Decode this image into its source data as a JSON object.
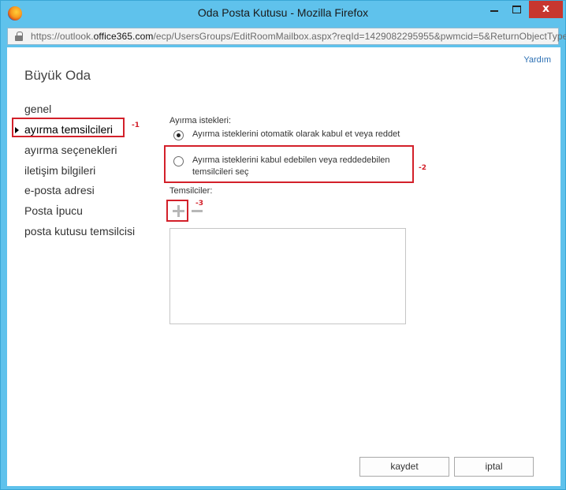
{
  "window": {
    "title": "Oda Posta Kutusu - Mozilla Firefox",
    "close_glyph": "x"
  },
  "address_bar": {
    "url_prefix": "https://outlook.",
    "url_domain": "office365.com",
    "url_path": "/ecp/UsersGroups/EditRoomMailbox.aspx?reqId=1429082295955&pwmcid=5&ReturnObjectType"
  },
  "page": {
    "help_label": "Yardım",
    "title": "Büyük Oda"
  },
  "nav": {
    "items": [
      {
        "label": "genel"
      },
      {
        "label": "ayırma temsilcileri"
      },
      {
        "label": "ayırma seçenekleri"
      },
      {
        "label": "iletişim bilgileri"
      },
      {
        "label": "e-posta adresi"
      },
      {
        "label": "Posta İpucu"
      },
      {
        "label": "posta kutusu temsilcisi"
      }
    ],
    "active_index": 1
  },
  "booking": {
    "label": "Ayırma istekleri:",
    "options": [
      {
        "label": "Ayırma isteklerini otomatik olarak kabul et veya reddet",
        "checked": true
      },
      {
        "label": "Ayırma isteklerini kabul edebilen veya reddedebilen temsilcileri seç",
        "checked": false
      }
    ]
  },
  "delegates": {
    "label": "Temsilciler:",
    "add_icon": "plus-icon",
    "remove_icon": "minus-icon"
  },
  "annotations": {
    "marker_1": "-1",
    "marker_2": "-2",
    "marker_3": "-3",
    "color": "#d3202a"
  },
  "footer": {
    "save_label": "kaydet",
    "cancel_label": "iptal"
  }
}
